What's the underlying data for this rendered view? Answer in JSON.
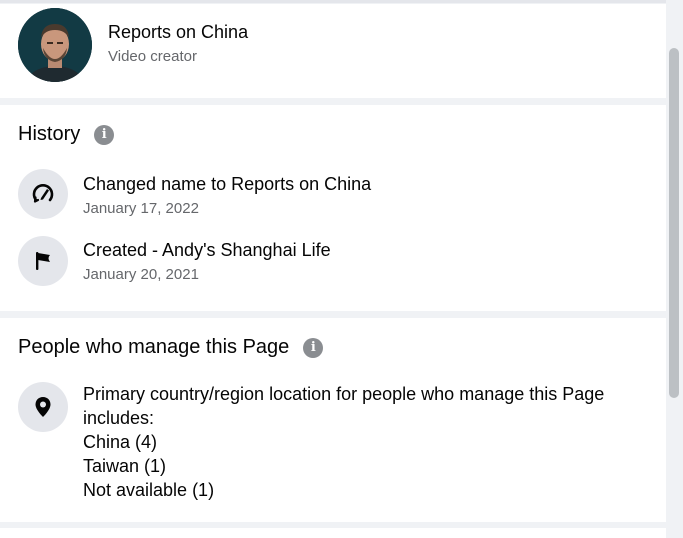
{
  "header": {
    "page_name": "Reports on China",
    "page_category": "Video creator"
  },
  "history": {
    "title": "History",
    "items": [
      {
        "label": "Changed name to Reports on China",
        "date": "January 17, 2022",
        "icon": "name-change-icon"
      },
      {
        "label": "Created - Andy's Shanghai Life",
        "date": "January 20, 2021",
        "icon": "flag-icon"
      }
    ]
  },
  "people": {
    "title": "People who manage this Page",
    "intro": "Primary country/region location for people who manage this Page includes:",
    "locations": [
      "China (4)",
      "Taiwan (1)",
      "Not available (1)"
    ],
    "icon": "location-pin-icon"
  },
  "colors": {
    "background": "#f0f2f5",
    "card": "#ffffff",
    "icon_circle": "#e4e6eb",
    "secondary_text": "#65676b",
    "info_icon": "#8a8d91"
  }
}
